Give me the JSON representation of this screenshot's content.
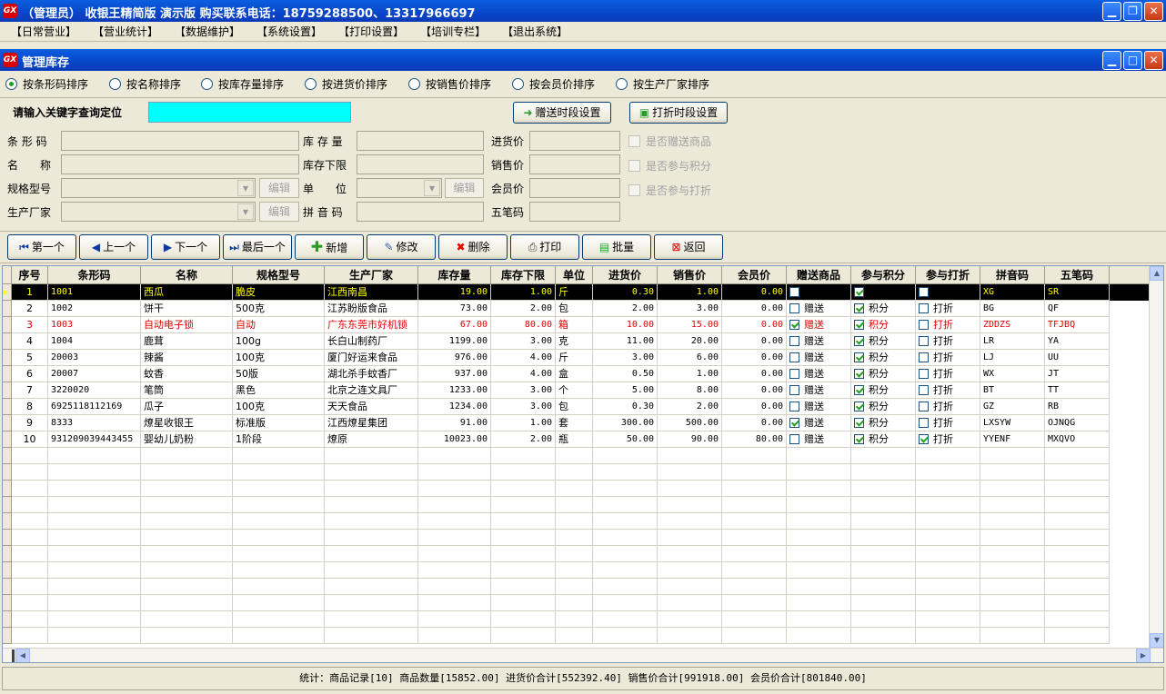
{
  "app": {
    "title": "（管理员） 收银王精简版 演示版 购买联系电话：18759288500、13317966697",
    "logo": "GX"
  },
  "menu": [
    "【日常营业】",
    "【营业统计】",
    "【数据维护】",
    "【系统设置】",
    "【打印设置】",
    "【培训专栏】",
    "【退出系统】"
  ],
  "window": {
    "title": "管理库存"
  },
  "sort_options": [
    {
      "label": "按条形码排序",
      "selected": true
    },
    {
      "label": "按名称排序",
      "selected": false
    },
    {
      "label": "按库存量排序",
      "selected": false
    },
    {
      "label": "按进货价排序",
      "selected": false
    },
    {
      "label": "按销售价排序",
      "selected": false
    },
    {
      "label": "按会员价排序",
      "selected": false
    },
    {
      "label": "按生产厂家排序",
      "selected": false
    }
  ],
  "search": {
    "label": "请输入关键字查询定位",
    "value": ""
  },
  "gift_period_button": "赠送时段设置",
  "discount_period_button": "打折时段设置",
  "form": {
    "barcode": "条 形 码",
    "name": "名　　称",
    "spec": "规格型号",
    "maker": "生产厂家",
    "stock": "库 存 量",
    "stock_min": "库存下限",
    "unit": "单　　位",
    "pinyin": "拼 音 码",
    "buy": "进货价",
    "sell": "销售价",
    "member": "会员价",
    "wubi": "五笔码",
    "edit": "编辑",
    "is_gift": "是否赠送商品",
    "is_points": "是否参与积分",
    "is_discount": "是否参与打折"
  },
  "nav": {
    "first": "第一个",
    "prev": "上一个",
    "next": "下一个",
    "last": "最后一个",
    "add": "新增",
    "edit": "修改",
    "del": "删除",
    "print": "打印",
    "batch": "批量",
    "back": "返回"
  },
  "columns": [
    "序号",
    "条形码",
    "名称",
    "规格型号",
    "生产厂家",
    "库存量",
    "库存下限",
    "单位",
    "进货价",
    "销售价",
    "会员价",
    "赠送商品",
    "参与积分",
    "参与打折",
    "拼音码",
    "五笔码"
  ],
  "rows": [
    {
      "no": "1",
      "code": "1001",
      "name": "西瓜",
      "spec": "脆皮",
      "maker": "江西南昌",
      "stock": "19.00",
      "min": "1.00",
      "unit": "斤",
      "buy": "0.30",
      "sell": "1.00",
      "member": "0.00",
      "gift": false,
      "gift_t": "",
      "pts": true,
      "pts_t": "",
      "disc": false,
      "disc_t": "",
      "py": "XG",
      "wb": "SR",
      "sel": true,
      "red": false
    },
    {
      "no": "2",
      "code": "1002",
      "name": "饼干",
      "spec": "500克",
      "maker": "江苏盼版食品",
      "stock": "73.00",
      "min": "2.00",
      "unit": "包",
      "buy": "2.00",
      "sell": "3.00",
      "member": "0.00",
      "gift": false,
      "gift_t": "赠送",
      "pts": true,
      "pts_t": "积分",
      "disc": false,
      "disc_t": "打折",
      "py": "BG",
      "wb": "QF",
      "sel": false,
      "red": false
    },
    {
      "no": "3",
      "code": "1003",
      "name": "自动电子锁",
      "spec": "自动",
      "maker": "广东东莞市好机锁",
      "stock": "67.00",
      "min": "80.00",
      "unit": "箱",
      "buy": "10.00",
      "sell": "15.00",
      "member": "0.00",
      "gift": true,
      "gift_t": "赠送",
      "pts": true,
      "pts_t": "积分",
      "disc": false,
      "disc_t": "打折",
      "py": "ZDDZS",
      "wb": "TFJBQ",
      "sel": false,
      "red": true
    },
    {
      "no": "4",
      "code": "1004",
      "name": "鹿茸",
      "spec": "100g",
      "maker": "长白山制药厂",
      "stock": "1199.00",
      "min": "3.00",
      "unit": "克",
      "buy": "11.00",
      "sell": "20.00",
      "member": "0.00",
      "gift": false,
      "gift_t": "赠送",
      "pts": true,
      "pts_t": "积分",
      "disc": false,
      "disc_t": "打折",
      "py": "LR",
      "wb": "YA",
      "sel": false,
      "red": false
    },
    {
      "no": "5",
      "code": "20003",
      "name": "辣酱",
      "spec": "100克",
      "maker": "厦门好运来食品",
      "stock": "976.00",
      "min": "4.00",
      "unit": "斤",
      "buy": "3.00",
      "sell": "6.00",
      "member": "0.00",
      "gift": false,
      "gift_t": "赠送",
      "pts": true,
      "pts_t": "积分",
      "disc": false,
      "disc_t": "打折",
      "py": "LJ",
      "wb": "UU",
      "sel": false,
      "red": false
    },
    {
      "no": "6",
      "code": "20007",
      "name": "蚊香",
      "spec": "50版",
      "maker": "湖北杀手蚊香厂",
      "stock": "937.00",
      "min": "4.00",
      "unit": "盒",
      "buy": "0.50",
      "sell": "1.00",
      "member": "0.00",
      "gift": false,
      "gift_t": "赠送",
      "pts": true,
      "pts_t": "积分",
      "disc": false,
      "disc_t": "打折",
      "py": "WX",
      "wb": "JT",
      "sel": false,
      "red": false
    },
    {
      "no": "7",
      "code": "3220020",
      "name": "笔筒",
      "spec": "黑色",
      "maker": "北京之连文具厂",
      "stock": "1233.00",
      "min": "3.00",
      "unit": "个",
      "buy": "5.00",
      "sell": "8.00",
      "member": "0.00",
      "gift": false,
      "gift_t": "赠送",
      "pts": true,
      "pts_t": "积分",
      "disc": false,
      "disc_t": "打折",
      "py": "BT",
      "wb": "TT",
      "sel": false,
      "red": false
    },
    {
      "no": "8",
      "code": "6925118112169",
      "name": "瓜子",
      "spec": "100克",
      "maker": "天天食品",
      "stock": "1234.00",
      "min": "3.00",
      "unit": "包",
      "buy": "0.30",
      "sell": "2.00",
      "member": "0.00",
      "gift": false,
      "gift_t": "赠送",
      "pts": true,
      "pts_t": "积分",
      "disc": false,
      "disc_t": "打折",
      "py": "GZ",
      "wb": "RB",
      "sel": false,
      "red": false
    },
    {
      "no": "9",
      "code": "8333",
      "name": "燎星收银王",
      "spec": "标准版",
      "maker": "江西燎星集团",
      "stock": "91.00",
      "min": "1.00",
      "unit": "套",
      "buy": "300.00",
      "sell": "500.00",
      "member": "0.00",
      "gift": true,
      "gift_t": "赠送",
      "pts": true,
      "pts_t": "积分",
      "disc": false,
      "disc_t": "打折",
      "py": "LXSYW",
      "wb": "OJNQG",
      "sel": false,
      "red": false
    },
    {
      "no": "10",
      "code": "931209039443455",
      "name": "婴幼儿奶粉",
      "spec": "1阶段",
      "maker": "燎原",
      "stock": "10023.00",
      "min": "2.00",
      "unit": "瓶",
      "buy": "50.00",
      "sell": "90.00",
      "member": "80.00",
      "gift": false,
      "gift_t": "赠送",
      "pts": true,
      "pts_t": "积分",
      "disc": true,
      "disc_t": "打折",
      "py": "YYENF",
      "wb": "MXQVO",
      "sel": false,
      "red": false
    }
  ],
  "status": "统计：商品记录[10] 商品数量[15852.00] 进货价合计[552392.40] 销售价合计[991918.00] 会员价合计[801840.00]"
}
